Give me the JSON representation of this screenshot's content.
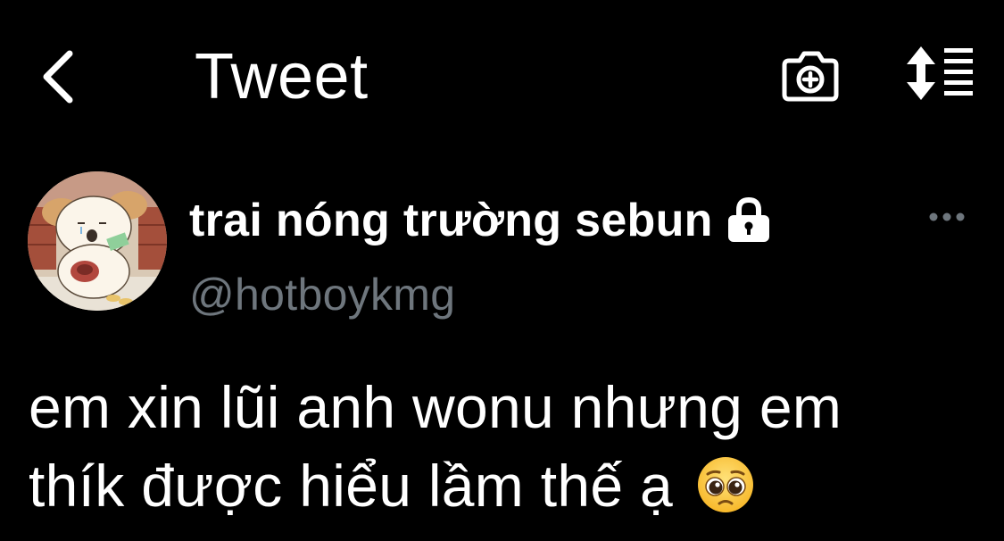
{
  "header": {
    "title": "Tweet",
    "back_icon": "chevron-left-icon",
    "camera_icon": "camera-plus-icon",
    "sort_icon": "sort-list-icon"
  },
  "tweet": {
    "author": {
      "display_name": "trai nóng trường sebun",
      "handle": "@hotboykmg",
      "protected": true,
      "lock_icon": "lock-icon"
    },
    "more_icon": "more-horizontal-icon",
    "text_line_1": "em xin lũi anh wonu nhưng em",
    "text_line_2": "thík được hiểu lầm thế ạ",
    "emoji": "pleading-face-emoji"
  },
  "colors": {
    "background": "#000000",
    "primary_text": "#ffffff",
    "secondary_text": "#6e767d"
  }
}
